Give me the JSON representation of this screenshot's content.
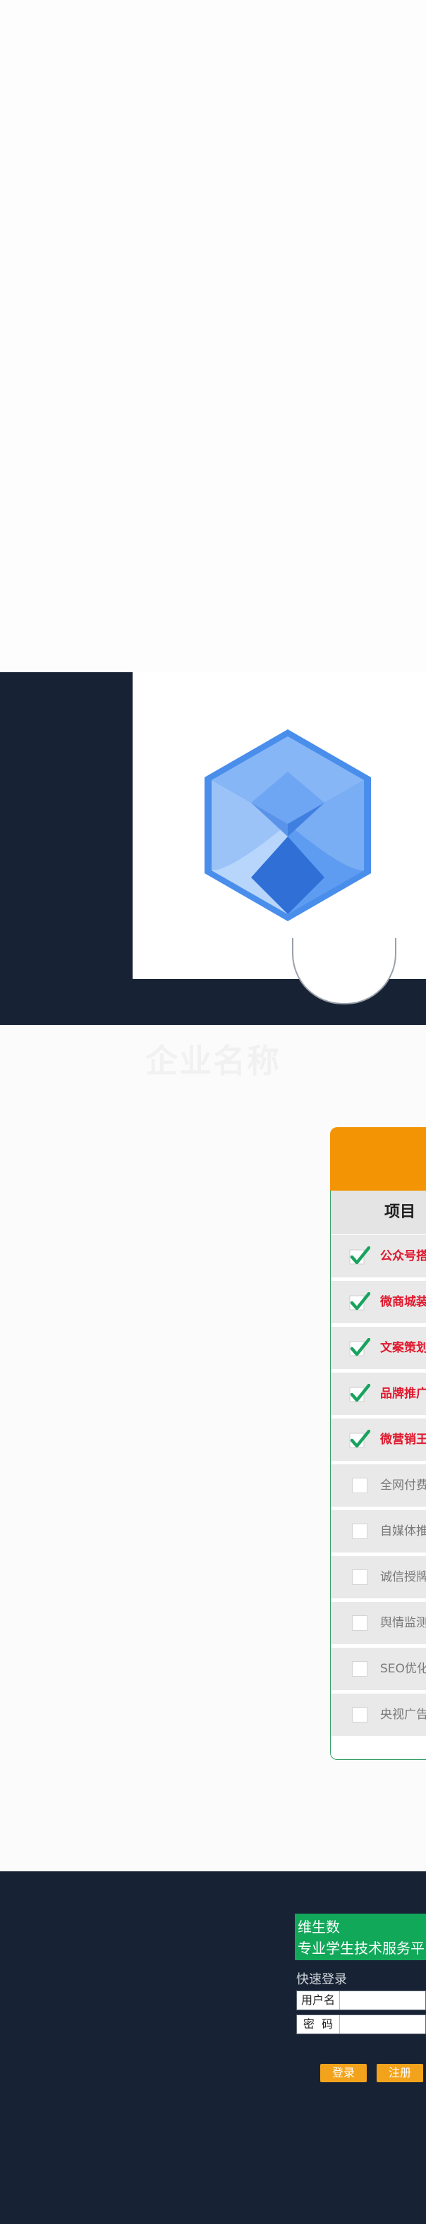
{
  "company": {
    "name": "企业名称",
    "logo_icon": "blue-hexagon-cube-icon"
  },
  "pricing_table": {
    "column_header": "项目",
    "rows": [
      {
        "label": "公众号搭建",
        "checked": true
      },
      {
        "label": "微商城装修",
        "checked": true
      },
      {
        "label": "文案策划",
        "checked": true
      },
      {
        "label": "品牌推广",
        "checked": true
      },
      {
        "label": "微营销王",
        "checked": true
      },
      {
        "label": "全网付费",
        "checked": false
      },
      {
        "label": "自媒体推广",
        "checked": false
      },
      {
        "label": "诚信授牌",
        "checked": false
      },
      {
        "label": "舆情监测",
        "checked": false
      },
      {
        "label": "SEO优化",
        "checked": false
      },
      {
        "label": "央视广告",
        "checked": false
      }
    ]
  },
  "footer": {
    "brand_line1": "维生数",
    "brand_line2": "专业学生技术服务平台",
    "quick_login": "快速登录",
    "username_label": "用户名",
    "password_label": "密  码",
    "login_button": "登录",
    "register_button": "注册"
  },
  "colors": {
    "dark_navy": "#172334",
    "orange": "#f39405",
    "green": "#11a85a",
    "checked_red": "#e0192e",
    "button_orange": "#f3a31b"
  }
}
